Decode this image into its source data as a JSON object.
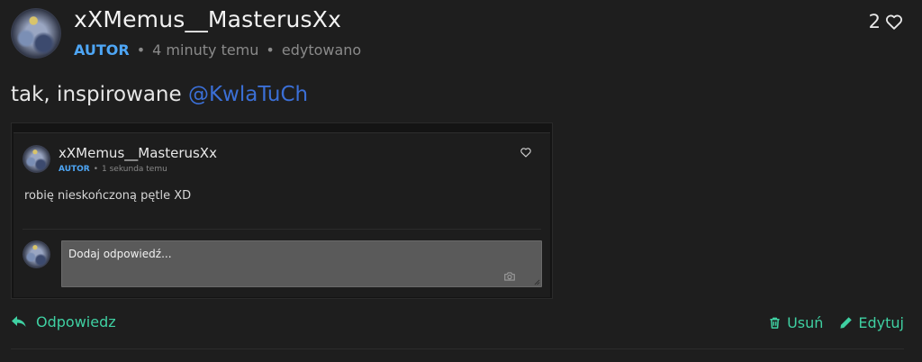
{
  "comment": {
    "author": "xXMemus__MasterusXx",
    "badge": "AUTOR",
    "time": "4 minuty temu",
    "edited": "edytowano",
    "likes": "2",
    "text_prefix": "tak, inspirowane ",
    "mention": "@KwlaTuCh"
  },
  "embed": {
    "author": "xXMemus__MasterusXx",
    "badge": "AUTOR",
    "time": "1 sekunda temu",
    "text": "robię nieskończoną pętle XD",
    "reply_placeholder": "Dodaj odpowiedź..."
  },
  "actions": {
    "reply": "Odpowiedz",
    "delete": "Usuń",
    "edit": "Edytuj"
  },
  "colors": {
    "accent": "#3fd0a2",
    "badge": "#4ea6f5",
    "mention": "#3b6fd6",
    "background": "#1e1e1e"
  },
  "icons": [
    "heart-icon",
    "reply-arrow-icon",
    "trash-icon",
    "pencil-icon",
    "camera-icon"
  ]
}
